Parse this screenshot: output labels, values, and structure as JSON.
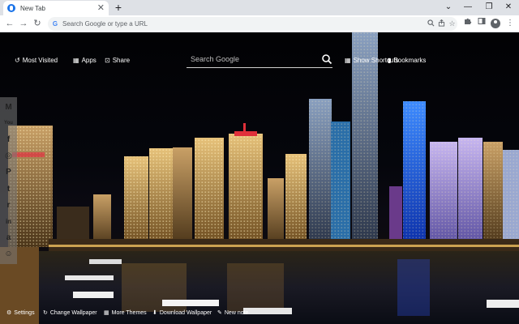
{
  "tab": {
    "title": "New Tab",
    "close": "✕",
    "new_tab": "+"
  },
  "window": {
    "chevron": "⌄",
    "minimize": "—",
    "restore": "❐",
    "close": "✕"
  },
  "toolbar": {
    "back": "←",
    "forward": "→",
    "reload": "↻",
    "omnibox_badge": "G",
    "omnibox_placeholder": "Search Google or type a URL",
    "menu": "⋮"
  },
  "top_links": {
    "most_visited": "Most Visited",
    "apps": "Apps",
    "share": "Share",
    "show_shortcuts": "Show Shortcuts",
    "bookmarks": "Bookmarks"
  },
  "search": {
    "placeholder": "Search Google"
  },
  "social": [
    {
      "name": "gmail",
      "glyph": "M"
    },
    {
      "name": "youtube",
      "glyph": "You"
    },
    {
      "name": "facebook",
      "glyph": "f"
    },
    {
      "name": "instagram",
      "glyph": "◎"
    },
    {
      "name": "pinterest",
      "glyph": "P"
    },
    {
      "name": "twitter",
      "glyph": "t"
    },
    {
      "name": "reddit",
      "glyph": "r"
    },
    {
      "name": "linkedin",
      "glyph": "in"
    },
    {
      "name": "amazon",
      "glyph": "a"
    },
    {
      "name": "vimeo",
      "glyph": "☺"
    }
  ],
  "bottom_links": {
    "settings": "Settings",
    "change_wallpaper": "Change Wallpaper",
    "more_themes": "More Themes",
    "download_wallpaper": "Download Wallpaper",
    "new_note": "New note"
  },
  "colors": {
    "accent": "#1a73e8",
    "chrome_bg": "#dee1e6",
    "omnibox_bg": "#f1f3f4"
  }
}
